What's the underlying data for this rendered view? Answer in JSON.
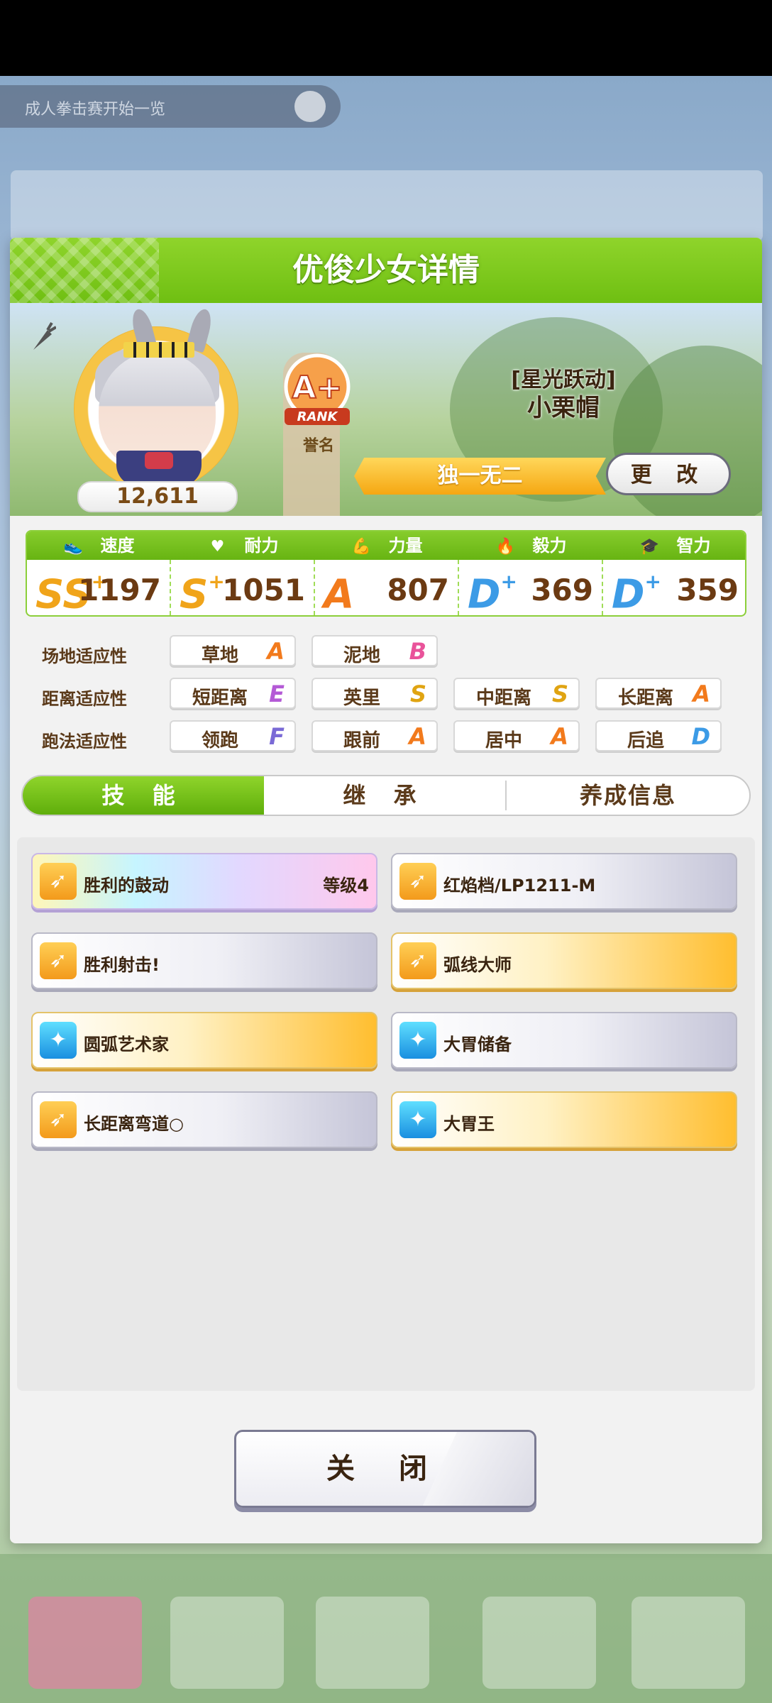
{
  "background": {
    "search_text": "成人拳击赛开始一览"
  },
  "dialog": {
    "title": "优俊少女详情",
    "fans": "12,611",
    "rank_grade": "A+",
    "rank_word": "RANK",
    "rank_label": "誉名",
    "epithet": "[星光跃动]",
    "name": "小栗帽",
    "unique_title": "独一无二",
    "change_label": "更 改"
  },
  "stats": [
    {
      "label": "速度",
      "icon": "shoe-icon",
      "grade": "SS",
      "plus": "+",
      "value": "1197",
      "color": "#f0a41a"
    },
    {
      "label": "耐力",
      "icon": "heart-icon",
      "grade": "S",
      "plus": "+",
      "value": "1051",
      "color": "#f0a41a"
    },
    {
      "label": "力量",
      "icon": "muscle-icon",
      "grade": "A",
      "plus": "",
      "value": "807",
      "color": "#f27a1c"
    },
    {
      "label": "毅力",
      "icon": "flame-icon",
      "grade": "D",
      "plus": "+",
      "value": "369",
      "color": "#3c9be6"
    },
    {
      "label": "智力",
      "icon": "graduation-cap-icon",
      "grade": "D",
      "plus": "+",
      "value": "359",
      "color": "#3c9be6"
    }
  ],
  "aptitude": {
    "track_label": "场地适应性",
    "distance_label": "距离适应性",
    "style_label": "跑法适应性",
    "track": [
      {
        "name": "草地",
        "grade": "A",
        "color": "#f27a1c"
      },
      {
        "name": "泥地",
        "grade": "B",
        "color": "#e9539a"
      }
    ],
    "distance": [
      {
        "name": "短距离",
        "grade": "E",
        "color": "#b45ad6"
      },
      {
        "name": "英里",
        "grade": "S",
        "color": "#e0a412"
      },
      {
        "name": "中距离",
        "grade": "S",
        "color": "#e0a412"
      },
      {
        "name": "长距离",
        "grade": "A",
        "color": "#f27a1c"
      }
    ],
    "style": [
      {
        "name": "领跑",
        "grade": "F",
        "color": "#7a6ad6"
      },
      {
        "name": "跟前",
        "grade": "A",
        "color": "#f27a1c"
      },
      {
        "name": "居中",
        "grade": "A",
        "color": "#f27a1c"
      },
      {
        "name": "后追",
        "grade": "D",
        "color": "#3c9be6"
      }
    ]
  },
  "tabs": [
    "技 能",
    "继 承",
    "养成信息"
  ],
  "skills": [
    {
      "name": "胜利的鼓动",
      "level": "等级4",
      "style": "rainbow",
      "icon": "speed-skill-icon"
    },
    {
      "name": "红焰档/LP1211-M",
      "level": "",
      "style": "white",
      "icon": "speed-skill-icon"
    },
    {
      "name": "胜利射击!",
      "level": "",
      "style": "white",
      "icon": "speed-skill-icon"
    },
    {
      "name": "弧线大师",
      "level": "",
      "style": "gold",
      "icon": "speed-skill-icon"
    },
    {
      "name": "圆弧艺术家",
      "level": "",
      "style": "gold",
      "icon": "recovery-skill-icon"
    },
    {
      "name": "大胃储备",
      "level": "",
      "style": "white",
      "icon": "recovery-skill-icon"
    },
    {
      "name": "长距离弯道○",
      "level": "",
      "style": "white",
      "icon": "speed-skill-icon"
    },
    {
      "name": "大胃王",
      "level": "",
      "style": "gold",
      "icon": "recovery-skill-icon"
    }
  ],
  "close_label": "关 闭"
}
